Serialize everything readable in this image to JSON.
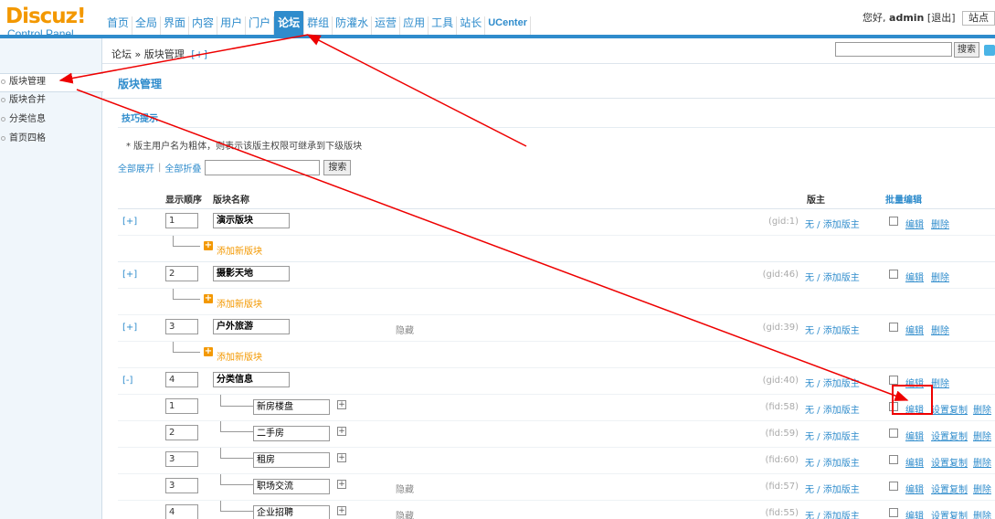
{
  "header": {
    "logo_main": "Discuz!",
    "logo_sub": "Control Panel",
    "nav": [
      "首页",
      "全局",
      "界面",
      "内容",
      "用户",
      "门户",
      "论坛",
      "群组",
      "防灌水",
      "运营",
      "应用",
      "工具",
      "站长",
      "UCenter"
    ],
    "active_nav": "论坛",
    "greeting": "您好,",
    "username": "admin",
    "logout": "[退出]",
    "site_btn": "站点"
  },
  "subheader": {
    "breadcrumb": "论坛 » 版块管理",
    "breadcrumb_add": "[+]",
    "search_button": "搜索"
  },
  "sidebar": {
    "items": [
      "版块管理",
      "版块合并",
      "分类信息",
      "首页四格"
    ]
  },
  "main": {
    "title": "版块管理",
    "tips_title": "技巧提示",
    "tips_text": "*  版主用户名为粗体，则表示该版主权限可继承到下级版块",
    "expand_all": "全部展开",
    "collapse_all": "全部折叠",
    "search_button": "搜索",
    "col_order": "显示顺序",
    "col_name": "版块名称",
    "col_moderator": "版主",
    "col_batch": "批量编辑",
    "add_forum": "添加新版块",
    "mod_text": "无 / 添加版主",
    "hidden": "隐藏",
    "edit": "编辑",
    "copy_settings": "设置复制",
    "delete": "删除",
    "groups": [
      {
        "toggle": "[+]",
        "order": "1",
        "name": "演示版块",
        "id": "(gid:1)",
        "hidden": false
      },
      {
        "toggle": "[+]",
        "order": "2",
        "name": "摄影天地",
        "id": "(gid:46)",
        "hidden": false
      },
      {
        "toggle": "[+]",
        "order": "3",
        "name": "户外旅游",
        "id": "(gid:39)",
        "hidden": true
      },
      {
        "toggle": "[-]",
        "order": "4",
        "name": "分类信息",
        "id": "(gid:40)",
        "hidden": false
      }
    ],
    "subforums": [
      {
        "order": "1",
        "name": "新房楼盘",
        "id": "(fid:58)",
        "hidden": false
      },
      {
        "order": "2",
        "name": "二手房",
        "id": "(fid:59)",
        "hidden": false
      },
      {
        "order": "3",
        "name": "租房",
        "id": "(fid:60)",
        "hidden": false
      },
      {
        "order": "3",
        "name": "职场交流",
        "id": "(fid:57)",
        "hidden": true
      },
      {
        "order": "4",
        "name": "企业招聘",
        "id": "(fid:55)",
        "hidden": true
      }
    ]
  }
}
